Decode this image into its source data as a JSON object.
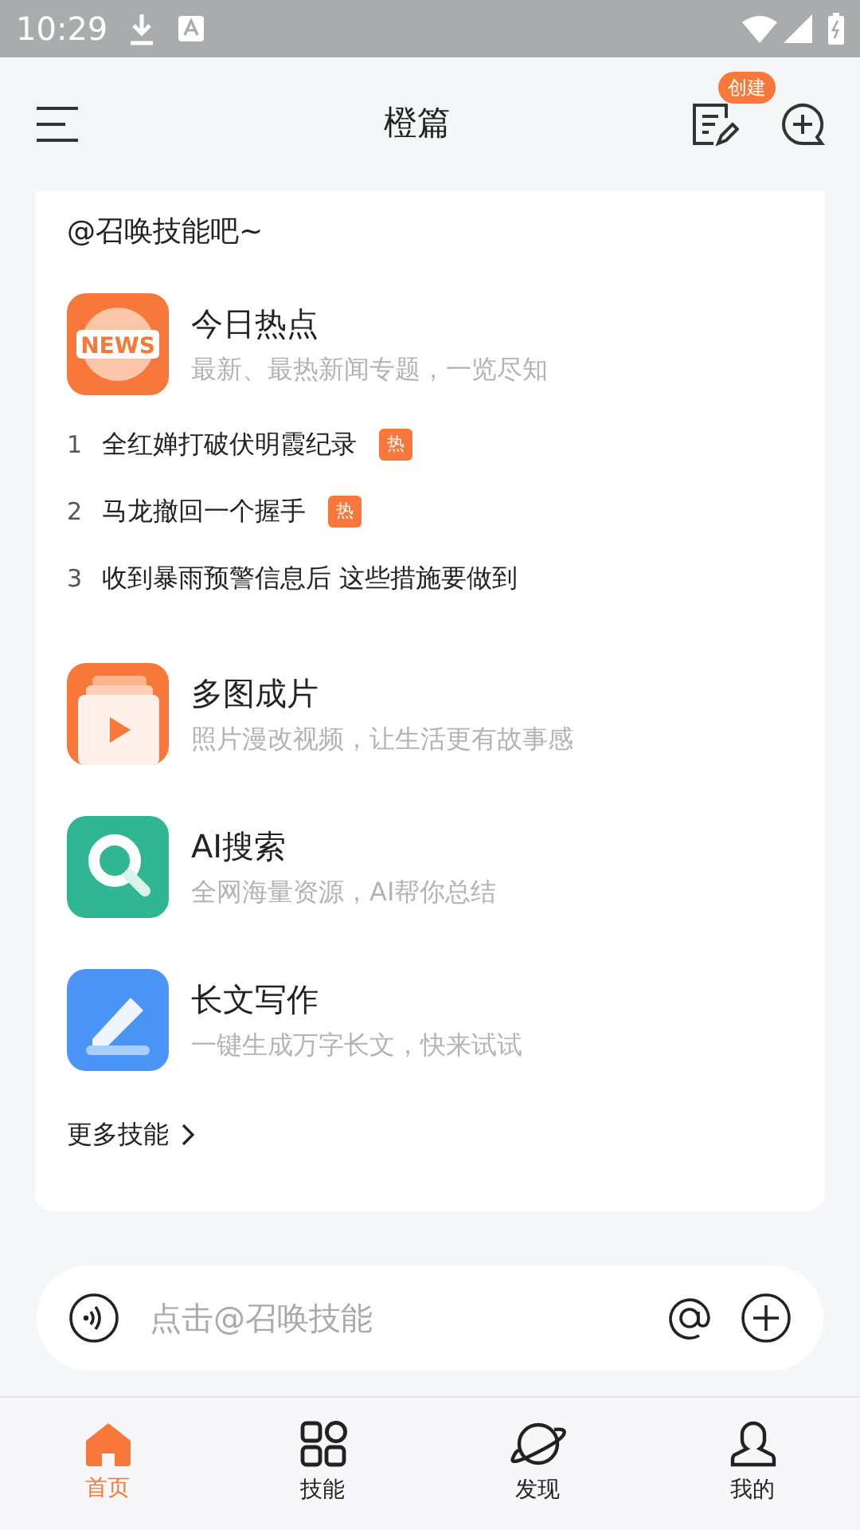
{
  "status_bar": {
    "time": "10:29"
  },
  "header": {
    "title": "橙篇",
    "create_badge": "创建"
  },
  "intro": {
    "text": "@召唤技能吧~"
  },
  "skills": [
    {
      "kind": "news",
      "title": "今日热点",
      "subtitle": "最新、最热新闻专题，一览尽知",
      "icon_text": "NEWS",
      "hot_list": [
        {
          "rank": "1",
          "title": "全红婵打破伏明霞纪录",
          "badge": "热"
        },
        {
          "rank": "2",
          "title": "马龙撤回一个握手",
          "badge": "热"
        },
        {
          "rank": "3",
          "title": "收到暴雨预警信息后 这些措施要做到"
        }
      ]
    },
    {
      "kind": "video",
      "title": "多图成片",
      "subtitle": "照片漫改视频，让生活更有故事感"
    },
    {
      "kind": "search",
      "title": "AI搜索",
      "subtitle": "全网海量资源，AI帮你总结"
    },
    {
      "kind": "write",
      "title": "长文写作",
      "subtitle": "一键生成万字长文，快来试试"
    }
  ],
  "more_link": "更多技能",
  "input": {
    "placeholder": "点击@召唤技能"
  },
  "nav": [
    {
      "kind": "home",
      "label": "首页",
      "selected": true
    },
    {
      "kind": "skills",
      "label": "技能",
      "selected": false
    },
    {
      "kind": "discover",
      "label": "发现",
      "selected": false
    },
    {
      "kind": "me",
      "label": "我的",
      "selected": false
    }
  ]
}
